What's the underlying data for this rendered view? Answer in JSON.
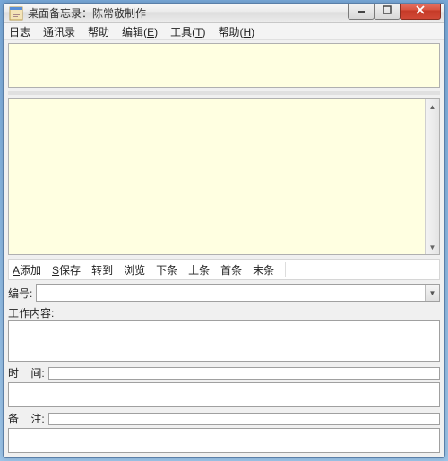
{
  "window": {
    "title": "桌面备忘录：陈常敬制作"
  },
  "menu": {
    "items": [
      {
        "label": "日志"
      },
      {
        "label": "通讯录"
      },
      {
        "label": "帮助"
      },
      {
        "label": "编辑",
        "accel": "E"
      },
      {
        "label": "工具",
        "accel": "T"
      },
      {
        "label": "帮助",
        "accel": "H"
      }
    ]
  },
  "toolbar": {
    "items": [
      {
        "label": "添加",
        "accel": "A"
      },
      {
        "label": "保存",
        "accel": "S"
      },
      {
        "label": "转到"
      },
      {
        "label": "浏览"
      },
      {
        "label": "下条"
      },
      {
        "label": "上条"
      },
      {
        "label": "首条"
      },
      {
        "label": "末条"
      }
    ]
  },
  "form": {
    "id_label": "编号:",
    "id_value": "",
    "work_label": "工作内容:",
    "work_value": "",
    "time_label": "时    间:",
    "time_value": "",
    "note_label": "备    注:",
    "note_value": ""
  },
  "icons": {
    "chevron_up": "▲",
    "chevron_down": "▼"
  }
}
